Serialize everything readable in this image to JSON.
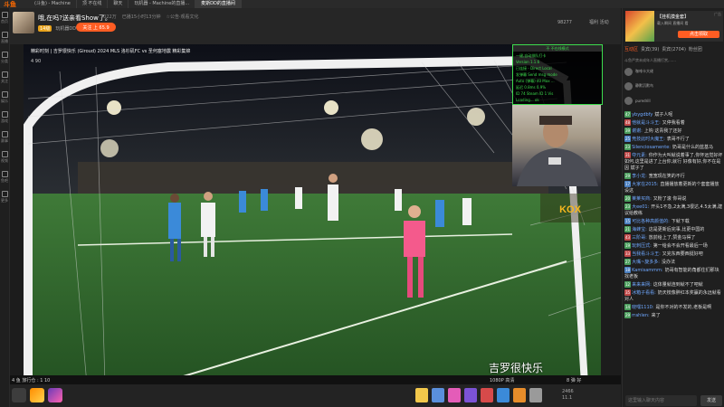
{
  "tabbar": {
    "logo": "斗鱼",
    "tabs": [
      {
        "label": "(斗鱼) - Machine"
      },
      {
        "label": "顶 不在线"
      },
      {
        "label": "聊天"
      },
      {
        "label": "玩机器 - Machine的直播..."
      },
      {
        "label": "麦斯DD的直播间"
      }
    ]
  },
  "leftnav": {
    "items": [
      "首页",
      "直播",
      "分类",
      "关注",
      "娱乐",
      "游戏",
      "赛事",
      "视频",
      "鱼吧",
      "更多"
    ]
  },
  "header": {
    "title": "哦,在吗?送亲看Show了。",
    "host_level": "14级",
    "host_name": "玩机器DD",
    "follow_label": "关注 上 65.9",
    "meta": [
      "1022万",
      "已播15小时13分钟",
      "☆公告·观看文化"
    ],
    "hot": "98277",
    "extra": "福利 活动"
  },
  "video": {
    "title": "精彩时刻 | 吉罗很快乐 (Giroud) 2024 MLS 洛杉矶FC vs 圣何塞地震 精彩集锦",
    "watermark": "4 90",
    "subtitle": "吉罗很快乐",
    "quality": "1080P 高清",
    "status_left": "4 鱼 旅行仓 : 1 10",
    "status_right": "8 弹 好"
  },
  "terminal": {
    "title": "不 不在线模式",
    "lines": [
      "一键,自动排队打卡",
      "Version 1.1.6",
      "已连接 - Direct Local",
      "发弹幕 Send msg mode",
      "Auto (弹幕) 40 Max ...",
      "延迟 0.8ms  0.9%",
      "ID 74   Steam ID 1 Vis",
      "Loading...  ok"
    ]
  },
  "bottombar": {
    "stats_line1": "2466",
    "stats_line2": "11.1"
  },
  "sidebar": {
    "ad_title": "【挂机摸金套】",
    "ad_sub": "载入瞬间 直播间 看",
    "ad_button": "点击领取",
    "ad_label": "广告",
    "tabs": [
      "互动区",
      "贵宾(39)",
      "贵宾(2704)",
      "粉丝团"
    ],
    "notice": "斗鱼严禁未成年人直播打赏,......",
    "ranks": [
      "咖啡卡大佬",
      "静默沉默鸟",
      "puredrill"
    ],
    "messages": [
      {
        "lvl": "47",
        "user": "ybygdbfy",
        "text": "斌子人呢",
        "lc": "#4a9e5c"
      },
      {
        "lvl": "48",
        "fan": "",
        "user": "他就是斗斗王:",
        "text": "又停我看着",
        "lc": "#c04848"
      },
      {
        "lvl": "39",
        "user": "谢谢:",
        "text": "上钩 这青我了还好",
        "lc": "#4a9e5c"
      },
      {
        "lvl": "25",
        "user": "竞技此时大魔王:",
        "text": "表哥不行了",
        "lc": "#4a7fc0"
      },
      {
        "lvl": "23",
        "user": "Silenciosamente:",
        "text": "奶哥是什么的蓝基马",
        "lc": "#4a9e5c"
      },
      {
        "lvl": "31",
        "user": "夺元素:",
        "text": "你作为大叫就说着事了,你怀远觉好坏如何,这里是进了上台你,就行 好像有好,你不在是因 斌子了",
        "lc": "#c04848"
      },
      {
        "lvl": "29",
        "user": "李小龙:",
        "text": "宽宽现在笑的不行",
        "lc": "#4a9e5c"
      },
      {
        "lvl": "17",
        "user": "大家在2015:",
        "text": "直播播放着更新的个套套播放设这",
        "lc": "#4a7fc0"
      },
      {
        "lvl": "20",
        "user": "莱莱买商:",
        "text": "又粉了滚 你哥说",
        "lc": "#4a9e5c"
      },
      {
        "lvl": "23",
        "user": "大ee01:",
        "text": "开头1不急,2太满,3很达,4.5太满,建议给教练",
        "lc": "#4a9e5c"
      },
      {
        "lvl": "15",
        "user": "可比各种高颜值的:",
        "text": "下就下载",
        "lc": "#4a7fc0"
      },
      {
        "lvl": "21",
        "user": "海蜂宝:",
        "text": "这是更新后完事,比更中国的",
        "lc": "#4a9e5c"
      },
      {
        "lvl": "43",
        "user": "三阶哥:",
        "text": "放前给上了,赞金马得了",
        "lc": "#c04848"
      },
      {
        "lvl": "19",
        "user": "玩刺压式:",
        "text": "第一给会不会开看最后一场",
        "lc": "#4a9e5c"
      },
      {
        "lvl": "33",
        "user": "当我看斗斗王:",
        "text": "又完东西要西挺好吧",
        "lc": "#c04848"
      },
      {
        "lvl": "27",
        "user": "大嘴~旋多多:",
        "text": "没办法",
        "lc": "#4a9e5c"
      },
      {
        "lvl": "18",
        "user": "Kamisammm:",
        "text": "奶哥有智能的角都住们那块找老板",
        "lc": "#4a7fc0"
      },
      {
        "lvl": "12",
        "user": "来来来网:",
        "text": "这体量就连到就不了吧就",
        "lc": "#4a9e5c"
      },
      {
        "lvl": "35",
        "user": "冰箱子看看:",
        "text": "奶天枝像胖红本奖赢的永远就看对人",
        "lc": "#c04848"
      },
      {
        "lvl": "14",
        "user": "晓嘿1110:",
        "text": "是你不对的不发的,老板是啊",
        "lc": "#4a9e5c"
      },
      {
        "lvl": "29",
        "user": "rrahlen:",
        "text": "来了",
        "lc": "#4a9e5c"
      }
    ],
    "input_placeholder": "这里输入聊天内容",
    "send_label": "发送"
  }
}
